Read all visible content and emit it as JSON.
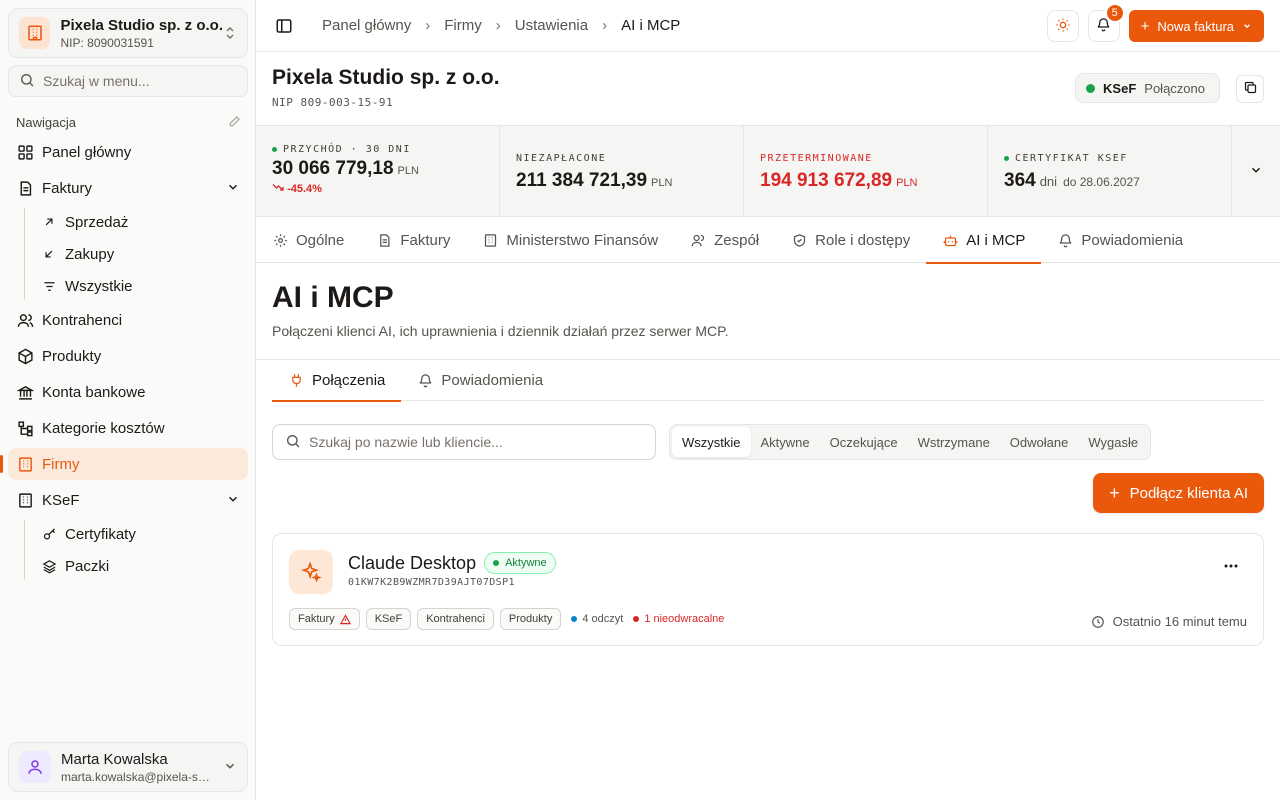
{
  "org": {
    "name": "Pixela Studio sp. z o.o.",
    "nip": "NIP: 8090031591"
  },
  "sidebar": {
    "search_placeholder": "Szukaj w menu...",
    "nav_heading": "Nawigacja",
    "items": [
      {
        "label": "Panel główny",
        "icon": "home-grid-icon"
      },
      {
        "label": "Faktury",
        "icon": "document-icon"
      },
      {
        "label": "Sprzedaż",
        "icon": "arrow-up-right-icon"
      },
      {
        "label": "Zakupy",
        "icon": "arrow-down-left-icon"
      },
      {
        "label": "Wszystkie",
        "icon": "filter-lines-icon"
      },
      {
        "label": "Kontrahenci",
        "icon": "users-icon"
      },
      {
        "label": "Produkty",
        "icon": "package-icon"
      },
      {
        "label": "Konta bankowe",
        "icon": "bank-icon"
      },
      {
        "label": "Kategorie kosztów",
        "icon": "tree-icon"
      },
      {
        "label": "Firmy",
        "icon": "building-icon"
      },
      {
        "label": "KSeF",
        "icon": "building-icon"
      },
      {
        "label": "Certyfikaty",
        "icon": "key-icon"
      },
      {
        "label": "Paczki",
        "icon": "layers-icon"
      }
    ]
  },
  "user": {
    "name": "Marta Kowalska",
    "email": "marta.kowalska@pixela-studio.pl"
  },
  "breadcrumb": [
    "Panel główny",
    "Firmy",
    "Ustawienia",
    "AI i MCP"
  ],
  "topbar": {
    "notifications_count": "5",
    "new_invoice_label": "Nowa faktura"
  },
  "company": {
    "name": "Pixela Studio sp. z o.o.",
    "nip": "NIP 809-003-15-91",
    "ksef_label": "KSeF",
    "ksef_state": "Połączono",
    "status_color": "#16a34a"
  },
  "stats": {
    "revenue": {
      "label": "PRZYCHÓD · 30 DNI",
      "value": "30 066 779,18",
      "unit": "PLN",
      "trend": "-45.4%"
    },
    "unpaid": {
      "label": "NIEZAPŁACONE",
      "value": "211 384 721,39",
      "unit": "PLN"
    },
    "overdue": {
      "label": "PRZETERMINOWANE",
      "value": "194 913 672,89",
      "unit": "PLN"
    },
    "certificate": {
      "label": "CERTYFIKAT KSEF",
      "value": "364",
      "unit": "dni",
      "extra": "do 28.06.2027"
    }
  },
  "tabs": [
    "Ogólne",
    "Faktury",
    "Ministerstwo Finansów",
    "Zespół",
    "Role i dostępy",
    "AI i MCP",
    "Powiadomienia"
  ],
  "section": {
    "title": "AI i MCP",
    "description": "Połączeni klienci AI, ich uprawnienia i dziennik działań przez serwer MCP."
  },
  "subtabs": [
    "Połączenia",
    "Powiadomienia"
  ],
  "filters": {
    "search_placeholder": "Szukaj po nazwie lub kliencie...",
    "segments": [
      "Wszystkie",
      "Aktywne",
      "Oczekujące",
      "Wstrzymane",
      "Odwołane",
      "Wygasłe"
    ]
  },
  "connect_button": "Podłącz klienta AI",
  "client": {
    "name": "Claude Desktop",
    "status": "Aktywne",
    "id": "01KW7K2B9WZMR7D39AJT07DSP1",
    "scopes": [
      "Faktury",
      "KSeF",
      "Kontrahenci",
      "Produkty"
    ],
    "reads": "4 odczyt",
    "irreversible": "1 nieodwracalne",
    "last_seen": "Ostatnio 16 minut temu"
  },
  "colors": {
    "accent": "#ea580c",
    "success": "#16a34a",
    "danger": "#dc2626"
  }
}
